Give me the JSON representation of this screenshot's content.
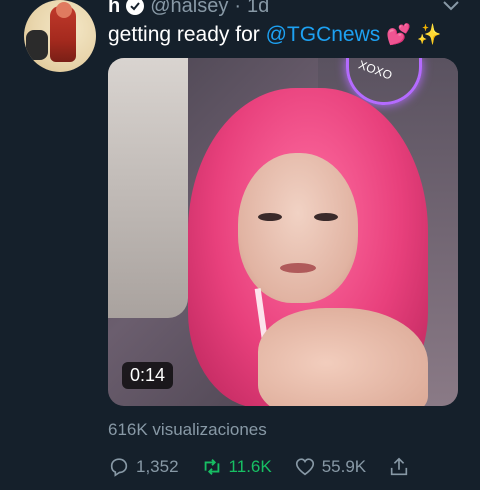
{
  "tweet": {
    "name": "h",
    "handle": "@halsey",
    "separator": "·",
    "time": "1d",
    "text_prefix": "getting ready for ",
    "mention": "@TGCnews",
    "emoji_hearts": "💕",
    "emoji_sparkles": "✨"
  },
  "media": {
    "neon_text": "XOXO",
    "duration": "0:14"
  },
  "stats": {
    "views": "616K visualizaciones",
    "replies": "1,352",
    "retweets": "11.6K",
    "likes": "55.9K"
  },
  "colors": {
    "background": "#15202b",
    "mention": "#1da1f2",
    "muted": "#8899a6",
    "retweet_active": "#17bf63"
  },
  "icons": {
    "verified": "verified-badge-icon",
    "chevron": "chevron-down-icon",
    "reply": "reply-icon",
    "retweet": "retweet-icon",
    "like": "heart-icon",
    "share": "share-icon"
  }
}
